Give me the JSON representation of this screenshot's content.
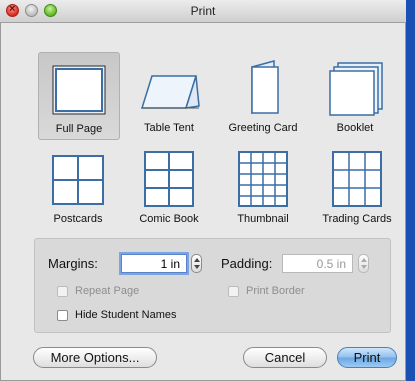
{
  "window": {
    "title": "Print"
  },
  "layouts_row1": [
    {
      "name": "full-page",
      "label": "Full Page",
      "selected": true
    },
    {
      "name": "table-tent",
      "label": "Table Tent",
      "selected": false
    },
    {
      "name": "greeting-card",
      "label": "Greeting Card",
      "selected": false
    },
    {
      "name": "booklet",
      "label": "Booklet",
      "selected": false
    }
  ],
  "layouts_row2": [
    {
      "name": "postcards",
      "label": "Postcards"
    },
    {
      "name": "comic-book",
      "label": "Comic Book"
    },
    {
      "name": "thumbnail",
      "label": "Thumbnail"
    },
    {
      "name": "trading-cards",
      "label": "Trading Cards"
    }
  ],
  "options": {
    "margins_label": "Margins:",
    "margins_value": "1 in",
    "padding_label": "Padding:",
    "padding_value": "0.5 in",
    "repeat_page_label": "Repeat Page",
    "print_border_label": "Print Border",
    "hide_names_label": "Hide Student Names"
  },
  "buttons": {
    "more_options": "More Options...",
    "cancel": "Cancel",
    "print": "Print"
  }
}
